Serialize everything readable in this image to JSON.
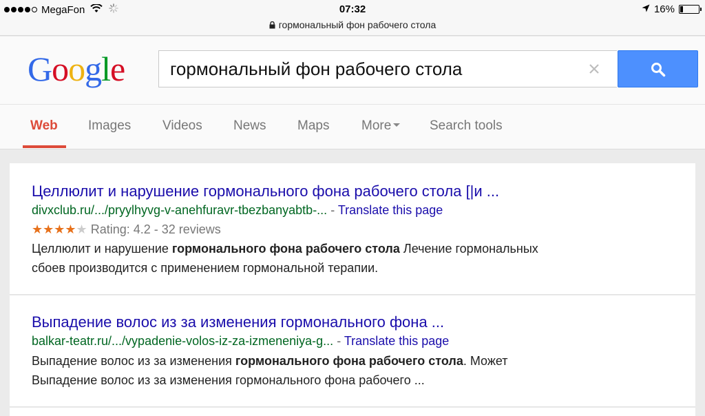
{
  "status": {
    "carrier": "MegaFon",
    "time": "07:32",
    "url": "гормональный фон рабочего стола",
    "battery": "16%"
  },
  "logo": {
    "letters": [
      {
        "ch": "G",
        "color": "#3369e8"
      },
      {
        "ch": "o",
        "color": "#d50f25"
      },
      {
        "ch": "o",
        "color": "#eeb211"
      },
      {
        "ch": "g",
        "color": "#3369e8"
      },
      {
        "ch": "l",
        "color": "#009925"
      },
      {
        "ch": "e",
        "color": "#d50f25"
      }
    ]
  },
  "search": {
    "query": "гормональный фон рабочего стола"
  },
  "tabs": [
    {
      "label": "Web",
      "active": true
    },
    {
      "label": "Images"
    },
    {
      "label": "Videos"
    },
    {
      "label": "News"
    },
    {
      "label": "Maps"
    },
    {
      "label": "More"
    },
    {
      "label": "Search tools"
    }
  ],
  "results": [
    {
      "title": "Целлюлит и нарушение гормонального фона рабочего стола [|и ...",
      "url": "divxclub.ru/.../pryylhyvg-v-anehfuravr-tbezbanyabtb-...",
      "separator": " - ",
      "translate": "Translate this page",
      "stars_filled": "★★★★",
      "stars_empty": "★",
      "rating_text": "Rating: 4.2 - 32 reviews",
      "rating_value": 4.2,
      "snippet": {
        "p1": "Целлюлит и нарушение ",
        "b1": "гормонального фона рабочего стола",
        "p2": " Лечение гормональных",
        "line2": "сбоев производится с применением гормональной терапии."
      }
    },
    {
      "title": "Выпадение волос из за изменения гормонального фона ...",
      "url": "balkar-teatr.ru/.../vypadenie-volos-iz-za-izmeneniya-g...",
      "separator": " - ",
      "translate": "Translate this page",
      "snippet": {
        "p1": "Выпадение волос из за изменения ",
        "b1": "гормонального фона рабочего стола",
        "p2": ". Может",
        "line2": "Выпадение волос из за изменения гормонального фона рабочего ..."
      }
    }
  ]
}
